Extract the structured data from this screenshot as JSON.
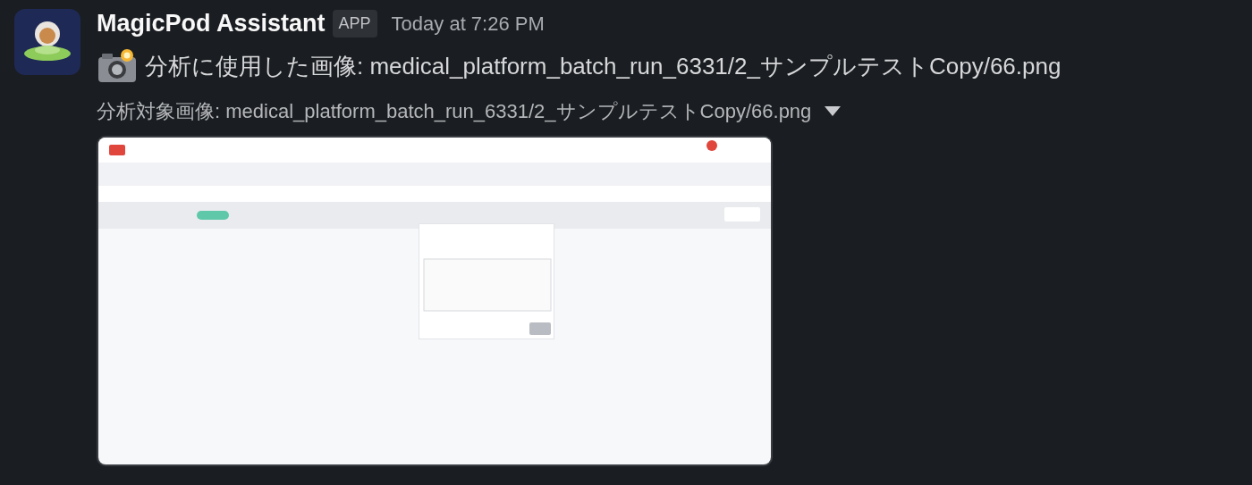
{
  "message": {
    "sender": "MagicPod Assistant",
    "badge": "APP",
    "time": "Today at 7:26 PM",
    "text": "分析に使用した画像: medical_platform_batch_run_6331/2_サンプルテストCopy/66.png"
  },
  "attachment": {
    "title": "分析対象画像: medical_platform_batch_run_6331/2_サンプルテストCopy/66.png",
    "expanded": true,
    "kind": "picture"
  }
}
